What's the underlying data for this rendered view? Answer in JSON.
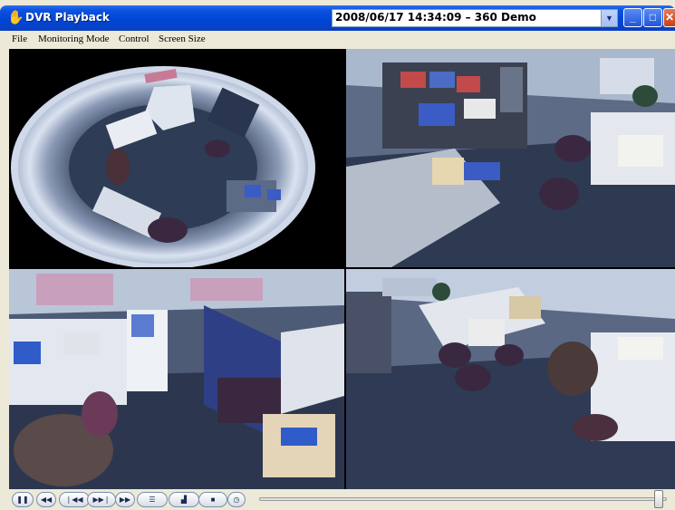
{
  "window": {
    "title": "DVR Playback",
    "clip_selector": {
      "value": "2008/06/17 14:34:09  – 360 Demo"
    }
  },
  "menu": [
    "File",
    "Monitoring Mode",
    "Control",
    "Screen Size"
  ],
  "playback": {
    "position_fraction": 0.99
  },
  "icons": {
    "app": "hand-icon",
    "controls": [
      "pause-icon",
      "rewind-icon",
      "skip-back-icon",
      "skip-forward-icon",
      "fast-forward-icon",
      "list-icon",
      "snapshot-icon",
      "stop-icon",
      "clock-icon"
    ]
  },
  "colors": {
    "title_bar": "#0046d6",
    "close_button": "#c4401a",
    "face": "#ece9d8"
  }
}
